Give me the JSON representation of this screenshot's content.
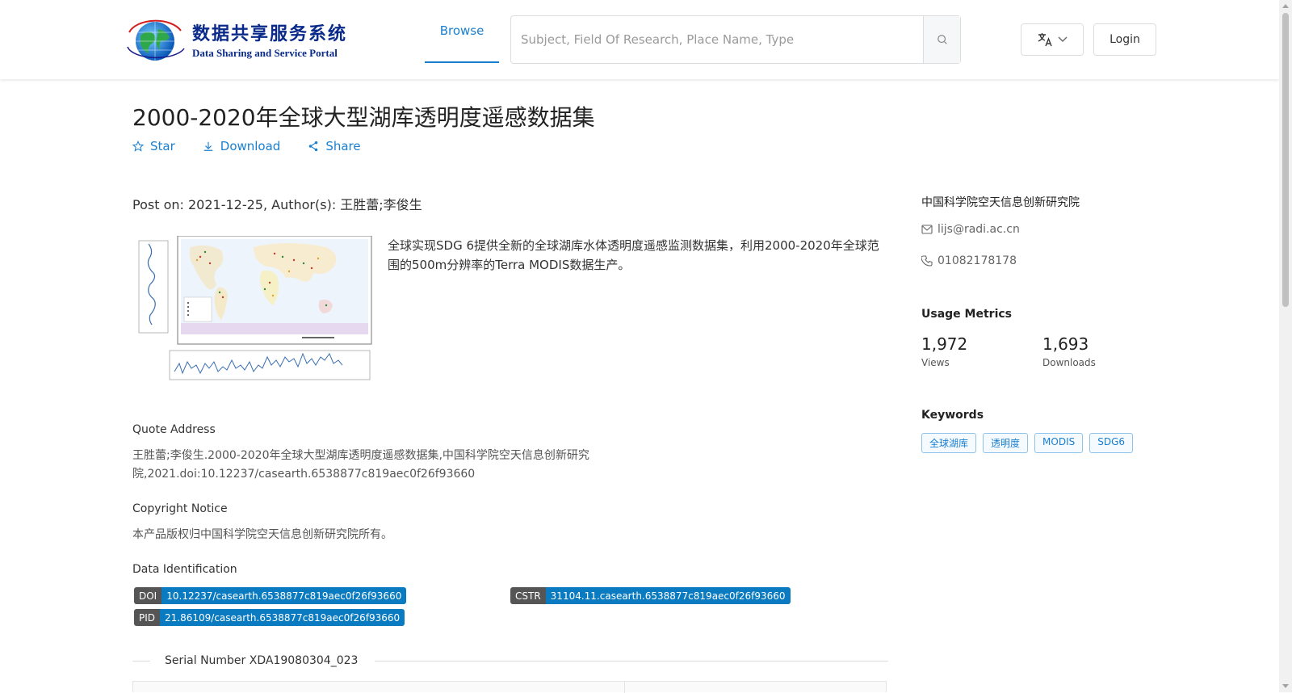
{
  "header": {
    "logo_cn": "数据共享服务系统",
    "logo_en": "Data Sharing and Service Portal",
    "nav_browse": "Browse",
    "search_placeholder": "Subject, Field Of Research, Place Name, Type",
    "login": "Login"
  },
  "dataset": {
    "title": "2000-2020年全球大型湖库透明度遥感数据集",
    "actions": {
      "star": "Star",
      "download": "Download",
      "share": "Share"
    },
    "post_on": "Post on: 2021-12-25, Author(s): 王胜蕾;李俊生",
    "description": "全球实现SDG 6提供全新的全球湖库水体透明度遥感监测数据集，利用2000-2020年全球范围的500m分辨率的Terra MODIS数据生产。"
  },
  "quote": {
    "title": "Quote Address",
    "line1": "王胜蕾;李俊生.2000-2020年全球大型湖库透明度遥感数据集,中国科学院空天信息创新研究",
    "line2": "院,2021.doi:10.12237/casearth.6538877c819aec0f26f93660"
  },
  "copyright": {
    "title": "Copyright Notice",
    "text": "本产品版权归中国科学院空天信息创新研究院所有。"
  },
  "identification": {
    "title": "Data Identification",
    "doi_key": "DOI",
    "doi_val": "10.12237/casearth.6538877c819aec0f26f93660",
    "cstr_key": "CSTR",
    "cstr_val": "31104.11.casearth.6538877c819aec0f26f93660",
    "pid_key": "PID",
    "pid_val": "21.86109/casearth.6538877c819aec0f26f93660"
  },
  "serial": "Serial Number XDA19080304_023",
  "side": {
    "org": "中国科学院空天信息创新研究院",
    "email": "lijs@radi.ac.cn",
    "phone": "01082178178",
    "metrics_title": "Usage Metrics",
    "views_value": "1,972",
    "views_label": "Views",
    "downloads_value": "1,693",
    "downloads_label": "Downloads",
    "keywords_title": "Keywords",
    "keywords": [
      "全球湖库",
      "透明度",
      "MODIS",
      "SDG6"
    ]
  },
  "colors": {
    "accent": "#1a7fd0",
    "badge_value": "#0a7bc0",
    "badge_key": "#555555"
  },
  "icons": [
    "globe-logo-icon",
    "search-icon",
    "translate-icon",
    "chevron-down-icon",
    "star-icon",
    "download-icon",
    "share-icon",
    "mail-icon",
    "phone-icon"
  ]
}
